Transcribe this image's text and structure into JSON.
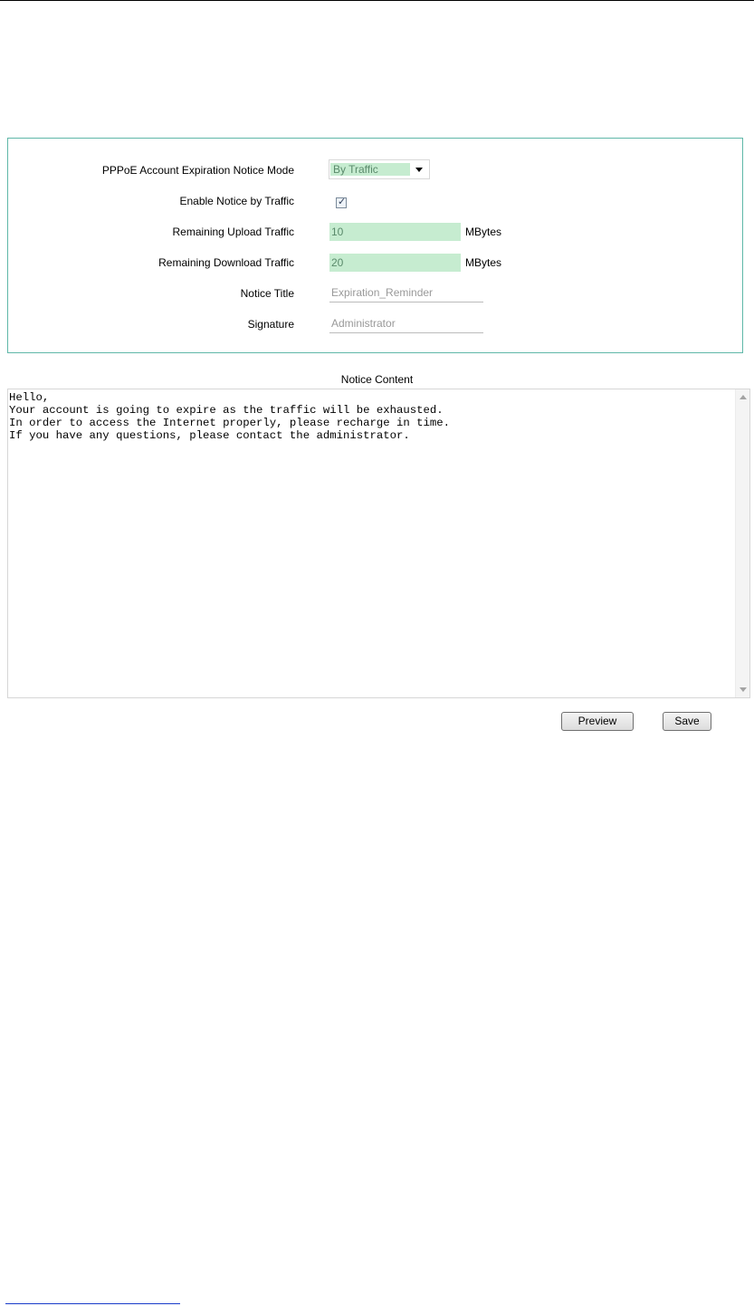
{
  "settings": {
    "mode_label": "PPPoE Account Expiration Notice Mode",
    "mode_value": "By Traffic",
    "enable_label": "Enable Notice by Traffic",
    "enable_checked": true,
    "upload_label": "Remaining Upload Traffic",
    "upload_value": "10",
    "upload_unit": "MBytes",
    "download_label": "Remaining Download Traffic",
    "download_value": "20",
    "download_unit": "MBytes",
    "title_label": "Notice Title",
    "title_value": "Expiration_Reminder",
    "signature_label": "Signature",
    "signature_value": "Administrator"
  },
  "notice": {
    "heading": "Notice Content",
    "content": "Hello,\nYour account is going to expire as the traffic will be exhausted.\nIn order to access the Internet properly, please recharge in time.\nIf you have any questions, please contact the administrator."
  },
  "buttons": {
    "preview_label": "Preview",
    "save_label": "Save"
  },
  "colors": {
    "panel_border": "#5fb7a8",
    "field_fill": "#c6ecd0"
  }
}
